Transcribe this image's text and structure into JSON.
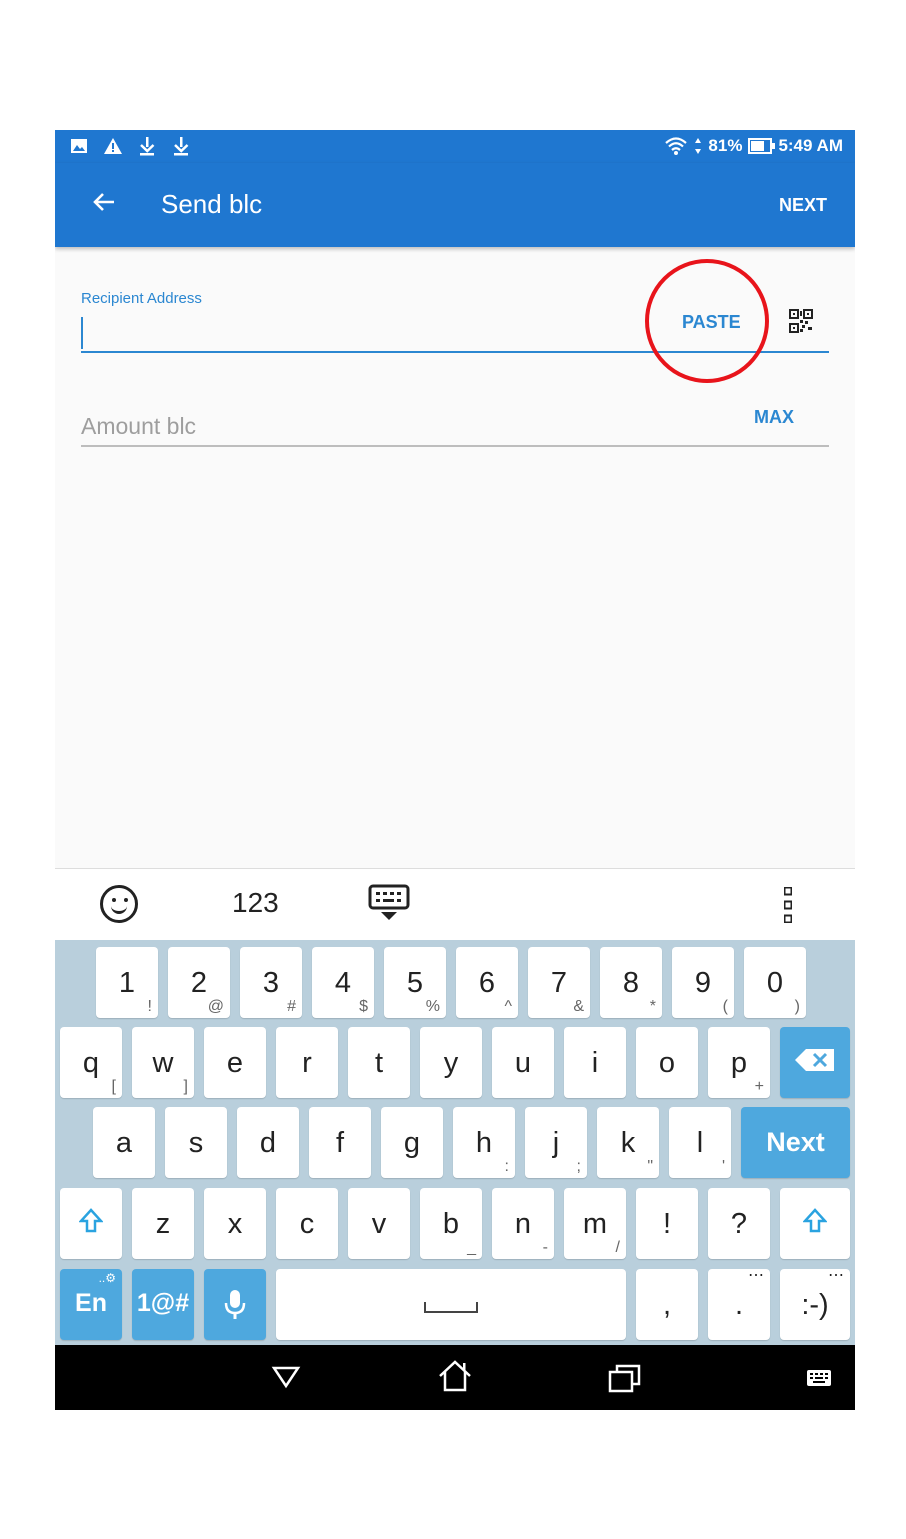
{
  "status_bar": {
    "battery": "81%",
    "time": "5:49 AM",
    "left_icons": [
      "image-icon",
      "warning-icon",
      "download-icon",
      "download-icon"
    ]
  },
  "app_bar": {
    "title": "Send blc",
    "action": "NEXT"
  },
  "form": {
    "recipient_label": "Recipient Address",
    "recipient_value": "",
    "paste_label": "PASTE",
    "amount_placeholder": "Amount blc",
    "max_label": "MAX"
  },
  "colors": {
    "primary": "#1f77d0",
    "accent": "#2b87d1",
    "highlight_circle": "#e8141b"
  },
  "keyboard": {
    "toolbar": {
      "numbers_label": "123"
    },
    "number_row": [
      {
        "main": "1",
        "sub": "!"
      },
      {
        "main": "2",
        "sub": "@"
      },
      {
        "main": "3",
        "sub": "#"
      },
      {
        "main": "4",
        "sub": "$"
      },
      {
        "main": "5",
        "sub": "%"
      },
      {
        "main": "6",
        "sub": "^"
      },
      {
        "main": "7",
        "sub": "&"
      },
      {
        "main": "8",
        "sub": "*"
      },
      {
        "main": "9",
        "sub": "("
      },
      {
        "main": "0",
        "sub": ")"
      }
    ],
    "row1": [
      {
        "main": "q",
        "sub": "["
      },
      {
        "main": "w",
        "sub": "]"
      },
      {
        "main": "e",
        "sub": ""
      },
      {
        "main": "r",
        "sub": ""
      },
      {
        "main": "t",
        "sub": ""
      },
      {
        "main": "y",
        "sub": ""
      },
      {
        "main": "u",
        "sub": ""
      },
      {
        "main": "i",
        "sub": ""
      },
      {
        "main": "o",
        "sub": ""
      },
      {
        "main": "p",
        "sub": "+"
      }
    ],
    "row2": [
      {
        "main": "a",
        "sub": ""
      },
      {
        "main": "s",
        "sub": ""
      },
      {
        "main": "d",
        "sub": ""
      },
      {
        "main": "f",
        "sub": ""
      },
      {
        "main": "g",
        "sub": ""
      },
      {
        "main": "h",
        "sub": ":"
      },
      {
        "main": "j",
        "sub": ";"
      },
      {
        "main": "k",
        "sub": "\""
      },
      {
        "main": "l",
        "sub": "'"
      }
    ],
    "next_label": "Next",
    "row3": [
      {
        "main": "z",
        "sub": ""
      },
      {
        "main": "x",
        "sub": ""
      },
      {
        "main": "c",
        "sub": ""
      },
      {
        "main": "v",
        "sub": ""
      },
      {
        "main": "b",
        "sub": "_"
      },
      {
        "main": "n",
        "sub": "-"
      },
      {
        "main": "m",
        "sub": "/"
      },
      {
        "main": "!",
        "sub": ""
      },
      {
        "main": "?",
        "sub": ""
      }
    ],
    "lang_label": "En",
    "symbols_label": "1@#",
    "comma": ",",
    "period": ".",
    "smiley": ":-)"
  }
}
